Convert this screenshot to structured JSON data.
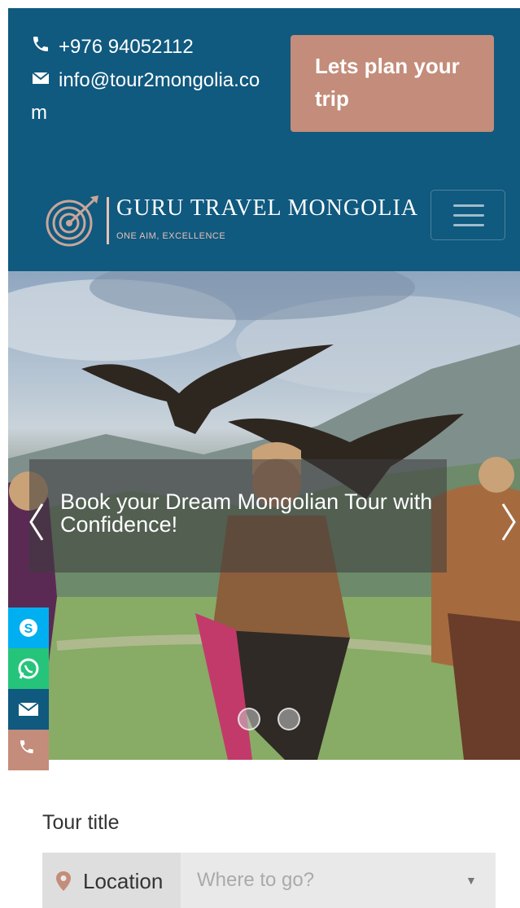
{
  "header": {
    "phone": "+976 94052112",
    "email": "info@tour2mongolia.com",
    "plan_button": "Lets plan your trip",
    "brand_name": "GURU TRAVEL MONGOLIA",
    "brand_tagline": "ONE AIM, EXCELLENCE",
    "colors": {
      "header_bg": "#10597f",
      "accent": "#c48c7a"
    }
  },
  "hero": {
    "caption": "Book your Dream Mongolian Tour with Confidence!",
    "slide_count": 2
  },
  "social": [
    {
      "name": "skype-icon",
      "color": "#00aff0"
    },
    {
      "name": "whatsapp-icon",
      "color": "#25c47a"
    },
    {
      "name": "email-icon",
      "color": "#10597f"
    },
    {
      "name": "phone-icon",
      "color": "#c48c7a"
    }
  ],
  "search": {
    "section_title": "Tour title",
    "location_label": "Location",
    "location_placeholder": "Where to go?"
  }
}
